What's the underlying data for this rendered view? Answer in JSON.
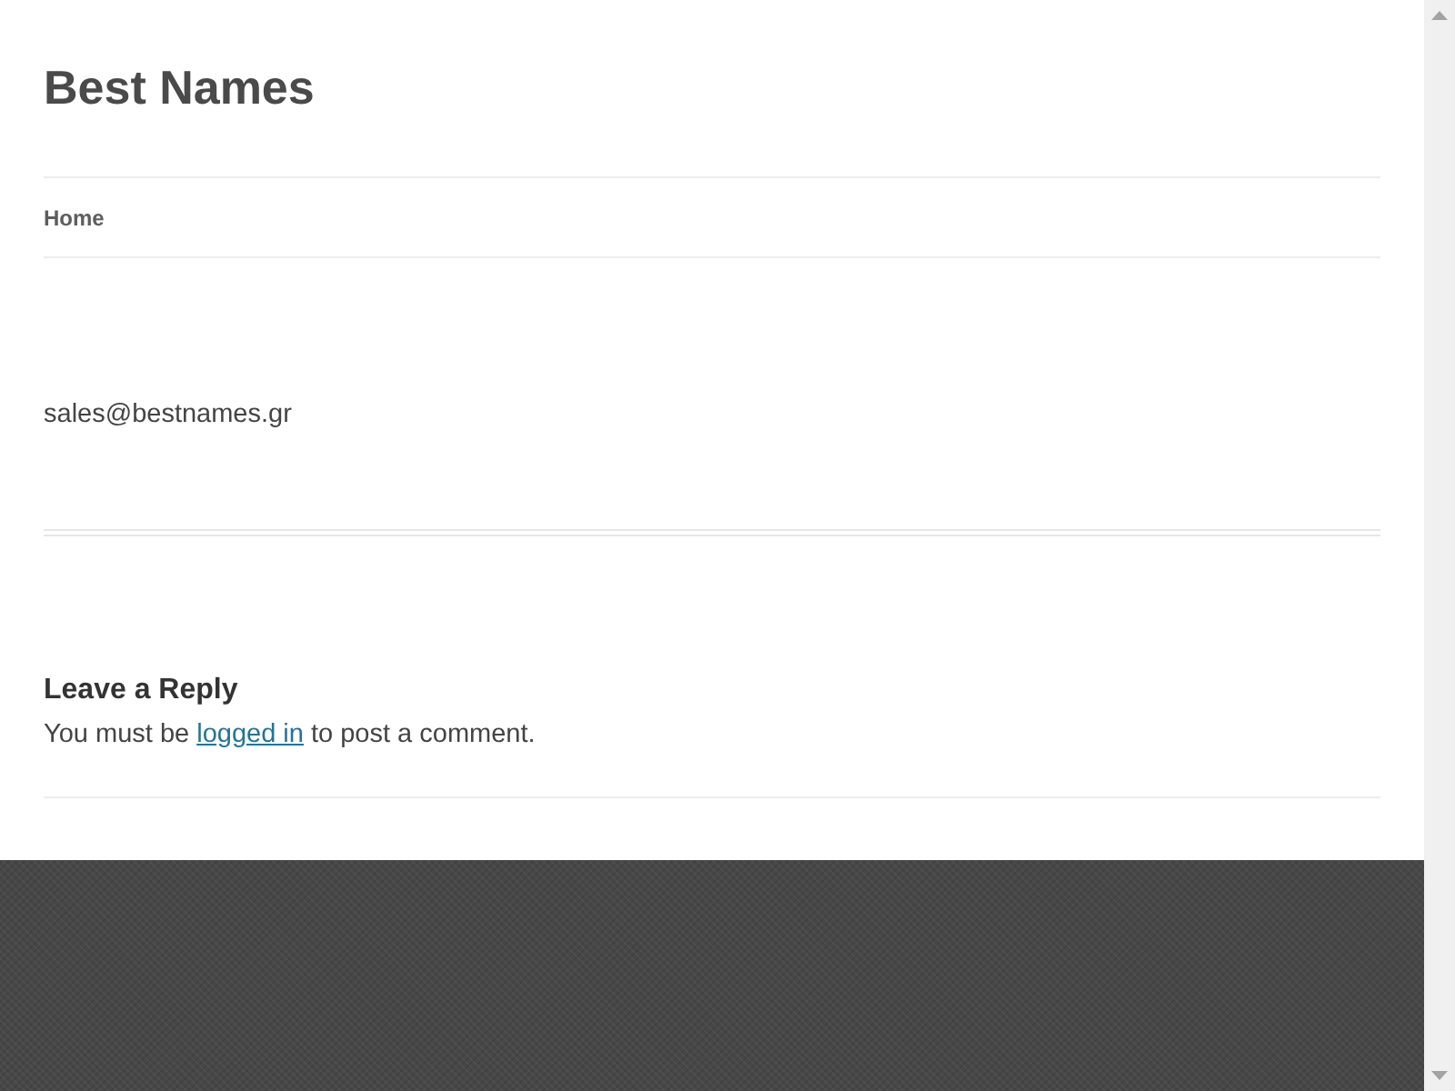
{
  "site_title": "Best Names",
  "nav": {
    "items": [
      {
        "label": "Home"
      }
    ]
  },
  "post": {
    "content": "sales@bestnames.gr"
  },
  "comments": {
    "heading": "Leave a Reply",
    "text_before": "You must be ",
    "link": "logged in",
    "text_after": " to post a comment."
  }
}
